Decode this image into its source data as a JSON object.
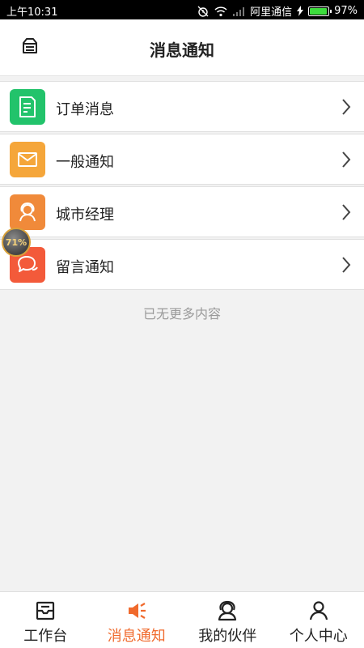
{
  "status_bar": {
    "time": "上午10:31",
    "carrier": "阿里通信",
    "battery": "97%",
    "battery_level": 0.97
  },
  "header": {
    "title": "消息通知",
    "menu_icon": "inbox-icon"
  },
  "list": {
    "items": [
      {
        "label": "订单消息",
        "icon": "document-icon",
        "color": "#22c36b"
      },
      {
        "label": "一般通知",
        "icon": "envelope-icon",
        "color": "#f5a63a"
      },
      {
        "label": "城市经理",
        "icon": "manager-icon",
        "color": "#f08a3a"
      },
      {
        "label": "留言通知",
        "icon": "chat-icon",
        "color": "#f35a3a"
      }
    ],
    "empty_note": "已无更多内容"
  },
  "float_badge": {
    "text": "71%"
  },
  "tabbar": {
    "active_color": "#f06a2d",
    "tabs": [
      {
        "label": "工作台",
        "icon": "workbench-icon",
        "active": false
      },
      {
        "label": "消息通知",
        "icon": "megaphone-icon",
        "active": true
      },
      {
        "label": "我的伙伴",
        "icon": "partner-icon",
        "active": false
      },
      {
        "label": "个人中心",
        "icon": "person-icon",
        "active": false
      }
    ]
  }
}
